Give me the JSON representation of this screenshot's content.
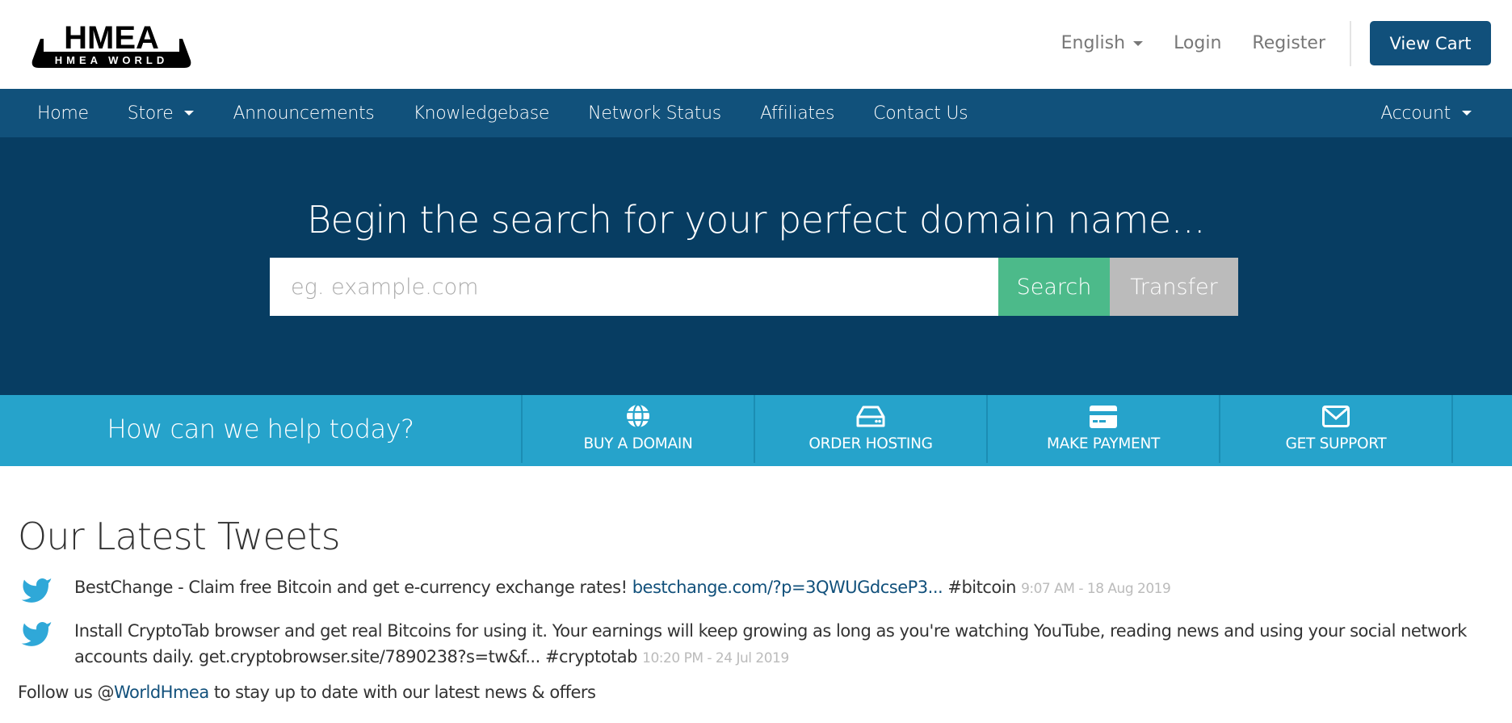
{
  "brand": {
    "logo_main": "HMEA",
    "logo_sub": "HMEA WORLD"
  },
  "topbar": {
    "language": "English",
    "login": "Login",
    "register": "Register",
    "view_cart": "View Cart"
  },
  "nav": {
    "items": [
      {
        "label": "Home",
        "dropdown": false
      },
      {
        "label": "Store",
        "dropdown": true
      },
      {
        "label": "Announcements",
        "dropdown": false
      },
      {
        "label": "Knowledgebase",
        "dropdown": false
      },
      {
        "label": "Network Status",
        "dropdown": false
      },
      {
        "label": "Affiliates",
        "dropdown": false
      },
      {
        "label": "Contact Us",
        "dropdown": false
      }
    ],
    "account": "Account"
  },
  "hero": {
    "title": "Begin the search for your perfect domain name...",
    "search_placeholder": "eg. example.com",
    "search_value": "",
    "search_button": "Search",
    "transfer_button": "Transfer"
  },
  "help": {
    "title": "How can we help today?",
    "items": [
      {
        "label": "BUY A DOMAIN",
        "icon": "globe-icon"
      },
      {
        "label": "ORDER HOSTING",
        "icon": "server-icon"
      },
      {
        "label": "MAKE PAYMENT",
        "icon": "credit-card-icon"
      },
      {
        "label": "GET SUPPORT",
        "icon": "envelope-icon"
      }
    ]
  },
  "tweets": {
    "heading": "Our Latest Tweets",
    "items": [
      {
        "text": "BestChange - Claim free Bitcoin and get e-currency exchange rates! ",
        "link": "bestchange.com/?p=3QWUGdcseP3...",
        "after": " #bitcoin ",
        "date": "9:07 AM - 18 Aug 2019"
      },
      {
        "text": "Install CryptoTab browser and get real Bitcoins for using it. Your earnings will keep growing as long as you're watching YouTube, reading news and using your social network accounts daily. get.cryptobrowser.site/7890238?s=tw&f... #cryptotab ",
        "link": "",
        "after": "",
        "date": "10:20 PM - 24 Jul 2019"
      }
    ],
    "follow_prefix": "Follow us @",
    "follow_handle": "WorldHmea",
    "follow_suffix": " to stay up to date with our latest news & offers"
  },
  "colors": {
    "nav_bg": "#11517b",
    "hero_bg": "#073d62",
    "help_bg": "#26a3cb",
    "search_btn": "#4cba8a",
    "transfer_btn": "#bbbbbb",
    "cart_btn": "#11507b",
    "twitter": "#2fa8d8",
    "link": "#11507b"
  }
}
